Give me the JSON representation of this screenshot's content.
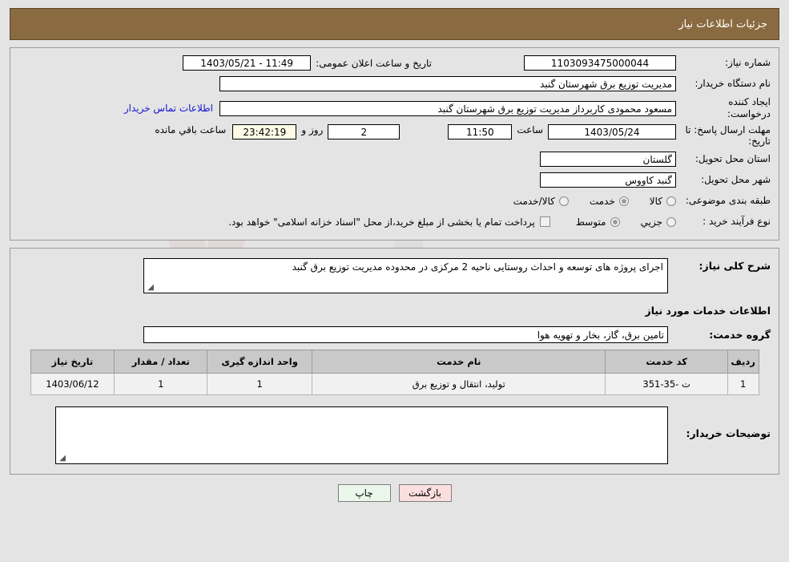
{
  "header": {
    "title": "جزئیات اطلاعات نیاز"
  },
  "top_form": {
    "need_number": {
      "label": "شماره نیاز:",
      "value": "1103093475000044"
    },
    "announce_datetime": {
      "label": "تاریخ و ساعت اعلان عمومی:",
      "value": "11:49 - 1403/05/21"
    },
    "buyer_org": {
      "label": "نام دستگاه خریدار:",
      "value": "مدیریت توزیع برق شهرستان گنبد"
    },
    "requester": {
      "label": "ایجاد کننده درخواست:",
      "value": "مسعود محمودی کاربرداز مدیریت توزیع برق شهرستان گنبد"
    },
    "contact_link": "اطلاعات تماس خریدار",
    "deadline": {
      "label": "مهلت ارسال پاسخ: تا تاریخ:",
      "date": "1403/05/24",
      "time_label": "ساعت",
      "time": "11:50",
      "days": "2",
      "days_suffix": "روز و",
      "countdown": "23:42:19",
      "countdown_suffix": "ساعت باقي مانده"
    },
    "province": {
      "label": "استان محل تحویل:",
      "value": "گلستان"
    },
    "city": {
      "label": "شهر محل تحویل:",
      "value": "گنبد کاووس"
    },
    "category": {
      "label": "طبقه بندی موضوعی:",
      "options": [
        "کالا",
        "خدمت",
        "کالا/خدمت"
      ],
      "selected": "خدمت"
    },
    "purchase_type": {
      "label": "نوع فرآیند خرید :",
      "options": [
        "جزیي",
        "متوسط"
      ],
      "selected": "متوسط",
      "checkbox_text": "پرداخت تمام یا بخشی از مبلغ خرید،از محل \"اسناد خزانه اسلامی\" خواهد بود.",
      "checkbox_checked": false
    }
  },
  "description_section": {
    "general_label": "شرح کلی نیاز:",
    "general_value": "اجرای پروژه های توسعه و احداث روستایی ناحیه 2 مرکزی در محدوده مدیریت توزیع برق گنبد",
    "services_heading": "اطلاعات خدمات مورد نیاز",
    "service_group_label": "گروه خدمت:",
    "service_group_value": "تامین برق، گاز، بخار و تهویه هوا"
  },
  "services_table": {
    "columns": [
      "ردیف",
      "کد خدمت",
      "نام خدمت",
      "واحد اندازه گیری",
      "تعداد / مقدار",
      "تاریخ نیاز"
    ],
    "rows": [
      {
        "row_no": "1",
        "code": "ت -35-351",
        "name": "تولید، انتقال و توزیع برق",
        "unit": "1",
        "quantity": "1",
        "need_date": "1403/06/12"
      }
    ]
  },
  "buyer_notes": {
    "label": "توضیحات خریدار:",
    "value": ""
  },
  "buttons": {
    "print": "چاپ",
    "back": "بازگشت"
  },
  "watermark": {
    "text": "AriaTender.net"
  },
  "colors": {
    "header_bg": "#8a6a40",
    "page_bg": "#e4e4e4",
    "link": "#1414d2",
    "table_header_bg": "#c9c9c9",
    "print_btn_bg": "#eaf7ea",
    "back_btn_bg": "#fbdede",
    "highlight_field_bg": "#fbfbe6"
  }
}
